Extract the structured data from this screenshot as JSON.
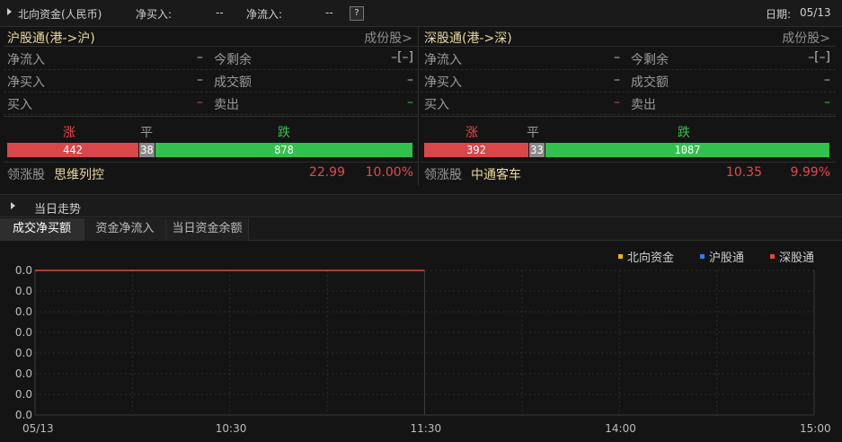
{
  "topbar": {
    "title": "北向资金(人民币)",
    "net_buy_label": "净买入:",
    "net_buy_value": "--",
    "net_inflow_label": "净流入:",
    "net_inflow_value": "--",
    "help": "?",
    "date_label": "日期:",
    "date_value": "05/13"
  },
  "panels": [
    {
      "name": "沪股通(港->沪)",
      "constituents": "成份股>",
      "rows": [
        {
          "k1": "净流入",
          "v1": "–",
          "k2": "今剩余",
          "v2": "–[–]",
          "c1": "gray",
          "c2": "gray"
        },
        {
          "k1": "净买入",
          "v1": "–",
          "k2": "成交额",
          "v2": "–",
          "c1": "gray",
          "c2": "gray"
        },
        {
          "k1": "买入",
          "v1": "–",
          "k2": "卖出",
          "v2": "–",
          "c1": "red",
          "c2": "green"
        }
      ],
      "up_label": "涨",
      "flat_label": "平",
      "down_label": "跌",
      "breadth": {
        "up": 442,
        "flat": 38,
        "down": 878
      },
      "leader_label": "领涨股",
      "leader_name": "思维列控",
      "leader_price": "22.99",
      "leader_pct": "10.00%"
    },
    {
      "name": "深股通(港->深)",
      "constituents": "成份股>",
      "rows": [
        {
          "k1": "净流入",
          "v1": "–",
          "k2": "今剩余",
          "v2": "–[–]",
          "c1": "gray",
          "c2": "gray"
        },
        {
          "k1": "净买入",
          "v1": "–",
          "k2": "成交额",
          "v2": "–",
          "c1": "gray",
          "c2": "gray"
        },
        {
          "k1": "买入",
          "v1": "–",
          "k2": "卖出",
          "v2": "–",
          "c1": "red",
          "c2": "green"
        }
      ],
      "up_label": "涨",
      "flat_label": "平",
      "down_label": "跌",
      "breadth": {
        "up": 392,
        "flat": 33,
        "down": 1087
      },
      "leader_label": "领涨股",
      "leader_name": "中通客车",
      "leader_price": "10.35",
      "leader_pct": "9.99%"
    }
  ],
  "section": {
    "title": "当日走势"
  },
  "tabs": [
    "成交净买额",
    "资金净流入",
    "当日资金余额"
  ],
  "colors": {
    "up": "#e8474a",
    "down": "#31c24e",
    "flat": "#9a9a9a",
    "north": "#f0b400",
    "sh": "#2f7fe6",
    "sz": "#e8473c"
  },
  "chart_data": {
    "type": "line",
    "series": [
      {
        "name": "北向资金",
        "color": "#f0b400",
        "x": [],
        "y": []
      },
      {
        "name": "沪股通",
        "color": "#2f7fe6",
        "x": [],
        "y": []
      },
      {
        "name": "深股通",
        "color": "#e8473c",
        "x": [
          "09:30",
          "11:30"
        ],
        "y": [
          0.0,
          0.0
        ]
      }
    ],
    "x_ticks": [
      "05/13",
      "10:30",
      "11:30",
      "14:00",
      "15:00"
    ],
    "y_ticks": [
      "0.0",
      "0.0",
      "0.0",
      "0.0",
      "0.0",
      "0.0",
      "0.0",
      "0.0"
    ],
    "legend_position": "top-right",
    "grid": true
  }
}
